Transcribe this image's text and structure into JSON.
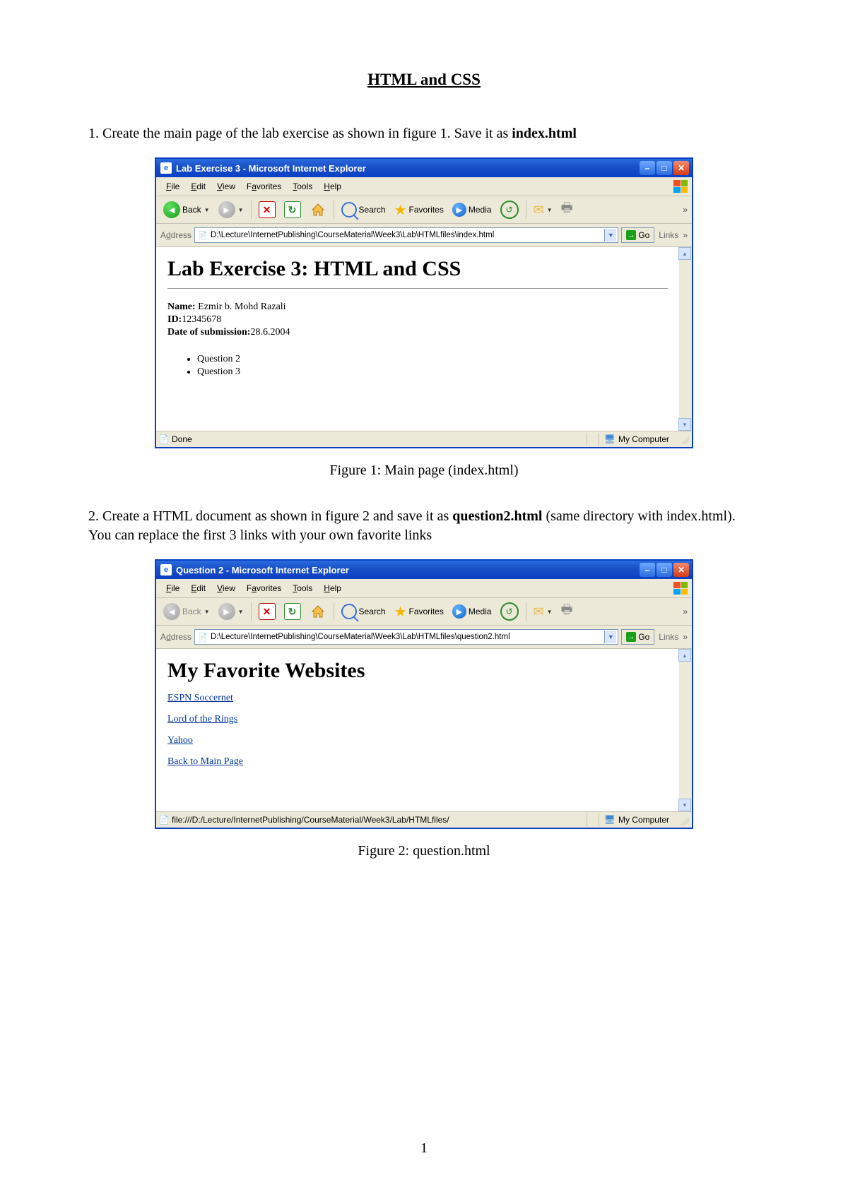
{
  "doc": {
    "title": "HTML and CSS",
    "instruction1_pre": "1. Create the main page of the lab exercise as shown in figure 1. Save it as ",
    "instruction1_bold": "index.html",
    "caption1": "Figure 1: Main page (index.html)",
    "instruction2_pre": "2.  Create a HTML document as shown in figure 2 and save it as ",
    "instruction2_bold": "question2.html",
    "instruction2_post": " (same directory with index.html). You can replace the first 3 links with your own favorite links",
    "caption2": "Figure 2: question.html",
    "page_number": "1"
  },
  "menus": {
    "file": "File",
    "edit": "Edit",
    "view": "View",
    "favorites": "Favorites",
    "tools": "Tools",
    "help": "Help"
  },
  "toolbar": {
    "back": "Back",
    "search": "Search",
    "favorites": "Favorites",
    "media": "Media"
  },
  "addressbar": {
    "label": "Address",
    "go": "Go",
    "links": "Links"
  },
  "fig1": {
    "title": "Lab Exercise 3 - Microsoft Internet Explorer",
    "url": "D:\\Lecture\\InternetPublishing\\CourseMaterial\\Week3\\Lab\\HTMLfiles\\index.html",
    "page": {
      "heading": "Lab Exercise 3: HTML and CSS",
      "name_label": "Name:",
      "name_value": " Ezmir b. Mohd Razali",
      "id_label": "ID:",
      "id_value": "12345678",
      "date_label": "Date of submission:",
      "date_value": "28.6.2004",
      "q2": "Question 2",
      "q3": "Question 3"
    },
    "status_left": "Done",
    "status_right": "My Computer"
  },
  "fig2": {
    "title": "Question 2 - Microsoft Internet Explorer",
    "url": "D:\\Lecture\\InternetPublishing\\CourseMaterial\\Week3\\Lab\\HTMLfiles\\question2.html",
    "page": {
      "heading": "My Favorite Websites",
      "link1": "ESPN Soccernet",
      "link2": "Lord of the Rings",
      "link3": "Yahoo",
      "link_back": "Back to Main Page"
    },
    "status_left": "file:///D:/Lecture/InternetPublishing/CourseMaterial/Week3/Lab/HTMLfiles/",
    "status_right": "My Computer"
  }
}
